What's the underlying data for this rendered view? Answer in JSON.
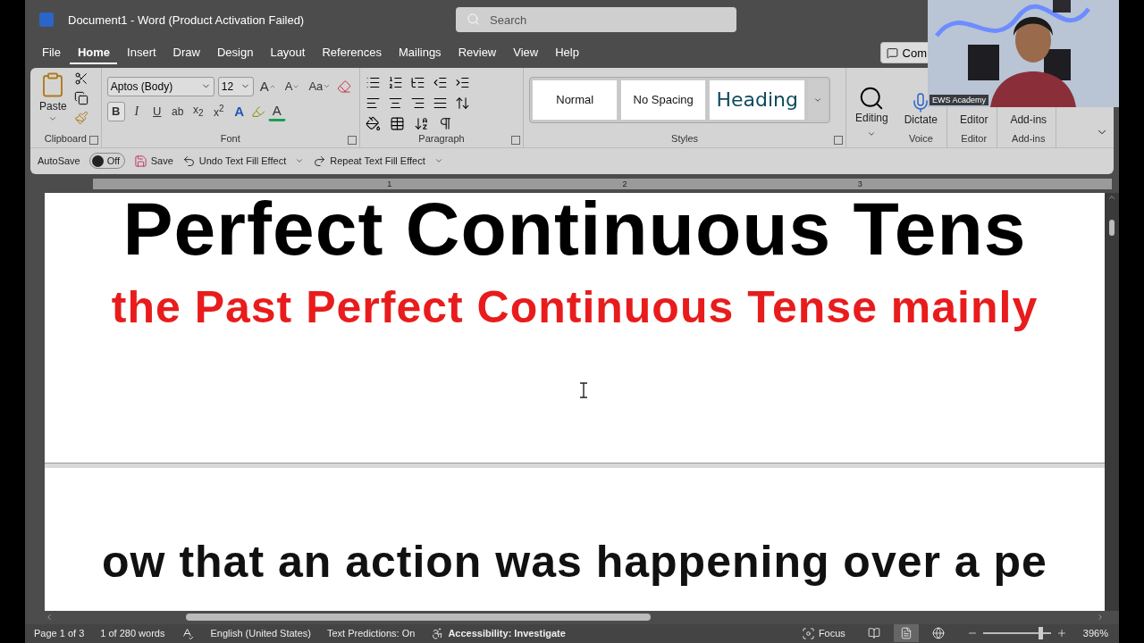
{
  "window": {
    "title": "Document1  -  Word (Product Activation Failed)",
    "search": {
      "placeholder": "Search"
    }
  },
  "tabs": [
    {
      "label": "File",
      "selected": false
    },
    {
      "label": "Home",
      "selected": true
    },
    {
      "label": "Insert",
      "selected": false
    },
    {
      "label": "Draw",
      "selected": false
    },
    {
      "label": "Design",
      "selected": false
    },
    {
      "label": "Layout",
      "selected": false
    },
    {
      "label": "References",
      "selected": false
    },
    {
      "label": "Mailings",
      "selected": false
    },
    {
      "label": "Review",
      "selected": false
    },
    {
      "label": "View",
      "selected": false
    },
    {
      "label": "Help",
      "selected": false
    }
  ],
  "comments_button": "Com",
  "ribbon": {
    "clipboard": {
      "paste": "Paste",
      "label": "Clipboard"
    },
    "font": {
      "name": "Aptos (Body)",
      "size": "12",
      "grow": "A",
      "shrink": "A",
      "case": "Aa",
      "styles": [
        {
          "label": "B",
          "kind": "bold",
          "selected": true
        },
        {
          "label": "I",
          "kind": "italic",
          "selected": false
        },
        {
          "label": "U",
          "kind": "underline",
          "selected": false
        },
        {
          "label": "ab",
          "kind": "strike",
          "selected": false
        },
        {
          "label": "x$_{2}$",
          "kind": "sub",
          "selected": false
        },
        {
          "label": "x$^{2}$",
          "kind": "sup",
          "selected": false
        }
      ],
      "effect": "A",
      "font_color": "A",
      "label": "Font"
    },
    "paragraph": {
      "label": "Paragraph"
    },
    "styles": {
      "items": [
        {
          "label": "Normal",
          "kind": "normal"
        },
        {
          "label": "No Spacing",
          "kind": "normal"
        },
        {
          "label": "Heading",
          "kind": "heading"
        }
      ],
      "label": "Styles"
    },
    "big_buttons": [
      {
        "label": "Editing",
        "kind": "editing"
      },
      {
        "label": "Dictate",
        "kind": "dictate"
      },
      {
        "label": "Editor",
        "kind": "covered"
      },
      {
        "label": "Add-ins",
        "kind": "covered"
      }
    ],
    "group_labels": [
      "Voice",
      "Editor",
      "Add-ins"
    ]
  },
  "quick_access": {
    "autosave": {
      "label": "AutoSave",
      "on": false,
      "state": "Off"
    },
    "save": "Save",
    "undo": "Undo Text Fill Effect",
    "repeat": "Repeat Text Fill Effect"
  },
  "ruler": [
    "1",
    "2",
    "3"
  ],
  "document": {
    "heading": "Perfect Continuous Tens",
    "red_line": "the Past Perfect Continuous Tense mainly",
    "next_page_line": "ow that an action was happening over a pe"
  },
  "webcam": {
    "kind": "picture",
    "name_tag": "EWS Academy"
  },
  "status_bar": {
    "page": "Page 1 of 3",
    "words": "1 of 280 words",
    "language": "English (United States)",
    "predictions": "Text Predictions: On",
    "accessibility": "Accessibility: Investigate",
    "focus": "Focus",
    "views": [
      {
        "kind": "read",
        "selected": false
      },
      {
        "kind": "print",
        "selected": true
      },
      {
        "kind": "web",
        "selected": false
      }
    ],
    "zoom": {
      "level": 0.84,
      "reading": "396%"
    }
  }
}
